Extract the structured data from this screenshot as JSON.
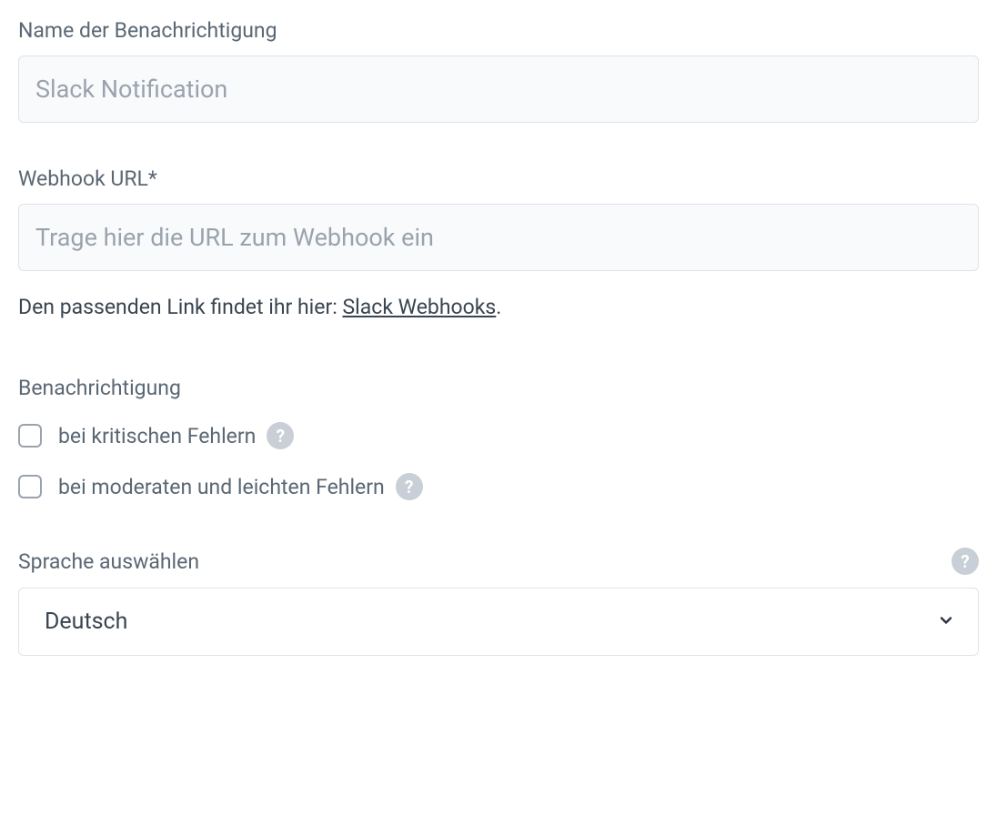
{
  "notification_name": {
    "label": "Name der Benachrichtigung",
    "placeholder": "Slack Notification",
    "value": ""
  },
  "webhook": {
    "label": "Webhook URL*",
    "placeholder": "Trage hier die URL zum Webhook ein",
    "value": "",
    "help_prefix": "Den passenden Link findet ihr hier: ",
    "help_link_text": "Slack Webhooks",
    "help_suffix": "."
  },
  "notification_section": {
    "heading": "Benachrichtigung",
    "critical": {
      "label": "bei kritischen Fehlern",
      "checked": false
    },
    "moderate": {
      "label": "bei moderaten und leichten Fehlern",
      "checked": false
    }
  },
  "language": {
    "label": "Sprache auswählen",
    "selected": "Deutsch"
  },
  "help_icon_glyph": "?"
}
